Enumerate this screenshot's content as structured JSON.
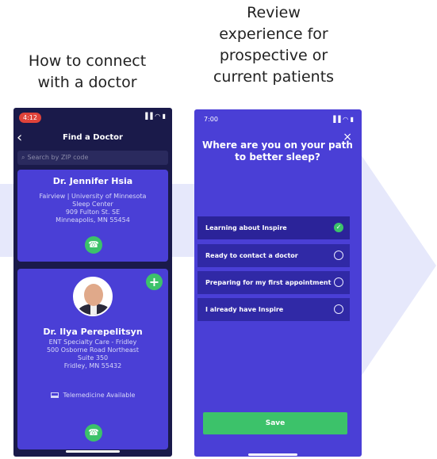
{
  "captions": {
    "left": [
      "How to connect",
      "with a doctor"
    ],
    "right": [
      "Review",
      "experience for",
      "prospective or",
      "current patients"
    ]
  },
  "find_doctor": {
    "status_time": "4:12",
    "status_icons": "▐▐ ◠ ▮",
    "back_icon": "‹",
    "title": "Find a Doctor",
    "search_icon": "⌕",
    "search_placeholder": "Search by ZIP code",
    "doctors": [
      {
        "name": "Dr. Jennifer Hsia",
        "address": [
          "Fairview | University of Minnesota",
          "Sleep Center",
          "909 Fulton St. SE",
          "Minneapolis, MN 55454"
        ],
        "call_icon": "☎"
      },
      {
        "name": "Dr. Ilya Perepelitsyn",
        "address": [
          "ENT Specialty Care - Fridley",
          "500 Osborne Road Northeast",
          "Suite 350",
          "Fridley, MN 55432"
        ],
        "telemedicine": "Telemedicine Available",
        "add_icon": "+",
        "call_icon": "☎"
      }
    ]
  },
  "sleep_path": {
    "status_time": "7:00",
    "status_icons": "▐▐ ◠ ▮",
    "close_icon": "×",
    "title": [
      "Where are you on your path",
      "to better sleep?"
    ],
    "options": [
      {
        "label": "Learning about Inspire",
        "selected": true,
        "check": "✓"
      },
      {
        "label": "Ready to contact a doctor",
        "selected": false
      },
      {
        "label": "Preparing for my first appointment",
        "selected": false
      },
      {
        "label": "I already have Inspire",
        "selected": false
      }
    ],
    "save_label": "Save"
  },
  "colors": {
    "accent_purple": "#4a3fd6",
    "dark_navy": "#1a1a4a",
    "success_green": "#3cc26a",
    "arrow_band": "#e6e8fb"
  }
}
